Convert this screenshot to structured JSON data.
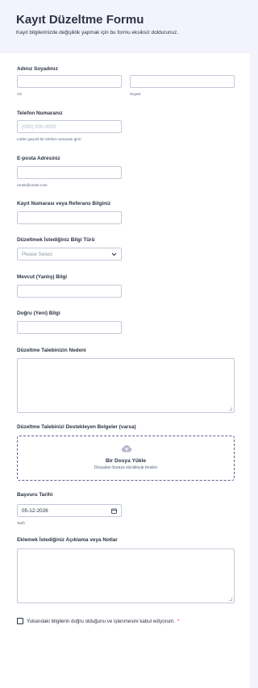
{
  "header": {
    "title": "Kayıt Düzeltme Formu",
    "subtitle": "Kayıt bilgilerinizde değişiklik yapmak için bu formu eksiksiz doldurunuz."
  },
  "fields": {
    "name": {
      "label": "Adınız Soyadınız",
      "first_sub": "Ad",
      "last_sub": "Soyad"
    },
    "phone": {
      "label": "Telefon Numaranız",
      "placeholder": "(000) 000-0000",
      "hint": "Lütfen geçerli bir telefon numarası girin."
    },
    "email": {
      "label": "E-posta Adresiniz",
      "hint": "ornek@ornek.com"
    },
    "reference": {
      "label": "Kayıt Numarası veya Referans Bilginiz"
    },
    "info_type": {
      "label": "Düzeltmek İstediğiniz Bilgi Türü",
      "selected": "Please Select"
    },
    "current": {
      "label": "Mevcut (Yanlış) Bilgi"
    },
    "correct": {
      "label": "Doğru (Yeni) Bilgi"
    },
    "reason": {
      "label": "Düzeltme Talebinizin Nedeni"
    },
    "documents": {
      "label": "Düzeltme Talebinizi Destekleyen Belgeler (varsa)",
      "upload_title": "Bir Dosya Yükle",
      "upload_hint": "Dosyaları buraya sürükleyip bırakın"
    },
    "date": {
      "label": "Başvuru Tarihi",
      "value": "05-12-2026",
      "sub": "Tarih"
    },
    "notes": {
      "label": "Eklemek İstediğiniz Açıklama veya Notlar"
    },
    "consent": {
      "label": "Yukarıdaki bilgilerin doğru olduğunu ve işlenmesini kabul ediyorum.",
      "required_mark": "*"
    }
  },
  "colors": {
    "background": "#f3f3fe",
    "card": "#ffffff",
    "border": "#c3cad8",
    "upload_border": "#56618c",
    "required": "#f23a3c"
  },
  "icons": {
    "dropdown": "chevron-down-icon",
    "upload": "cloud-upload-icon",
    "calendar": "calendar-icon"
  }
}
